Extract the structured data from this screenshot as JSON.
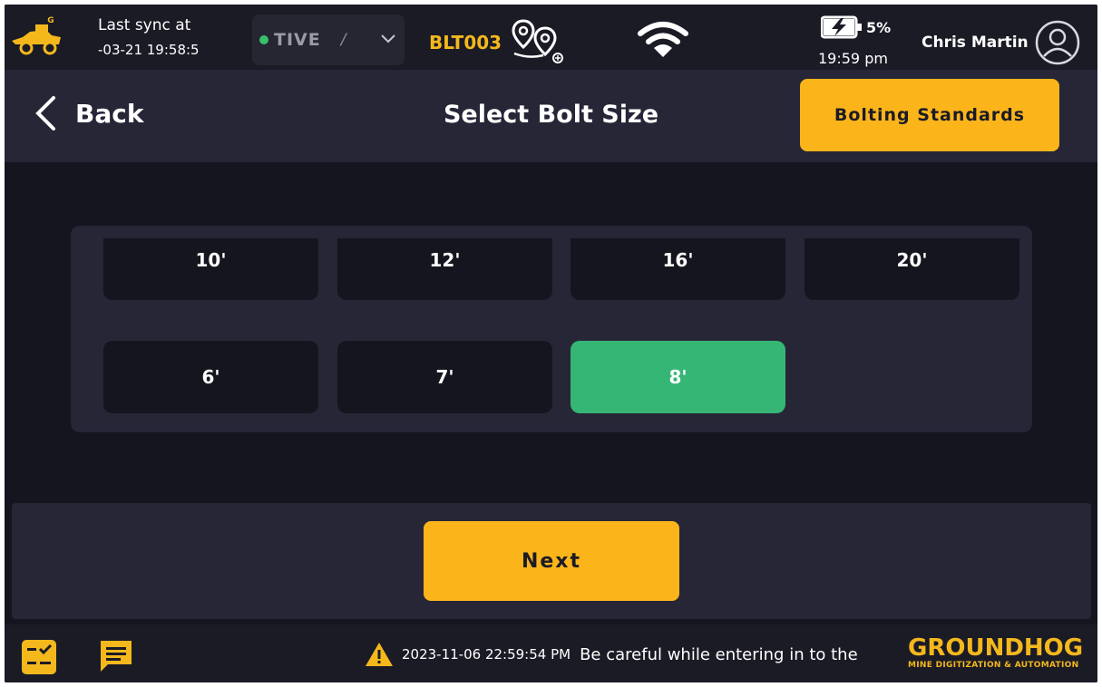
{
  "status_bar": {
    "sync_label": "Last sync at",
    "sync_time": "-03-21 19:58:5",
    "status_value": "TIVE",
    "status_separator": "/",
    "machine_id": "BLT003",
    "battery_pct": "5%",
    "clock": "19:59 pm",
    "user_name": "Chris Martin"
  },
  "header": {
    "back_label": "Back",
    "title": "Select Bolt Size",
    "standards_label": "Bolting Standards"
  },
  "bolt_sizes": {
    "row1": [
      "10'",
      "12'",
      "16'",
      "20'"
    ],
    "row2": [
      "6'",
      "7'",
      "8'"
    ],
    "selected": "8'"
  },
  "footer": {
    "next_label": "Next"
  },
  "bottom_bar": {
    "alert_time": "2023-11-06 22:59:54 PM",
    "alert_message": "Be careful while entering in to the",
    "brand_name": "GROUNDHOG",
    "brand_tagline": "MINE DIGITIZATION & AUTOMATION"
  },
  "colors": {
    "accent": "#fbb51b",
    "selected": "#36b675",
    "background": "#15151f",
    "panel": "#262637"
  }
}
